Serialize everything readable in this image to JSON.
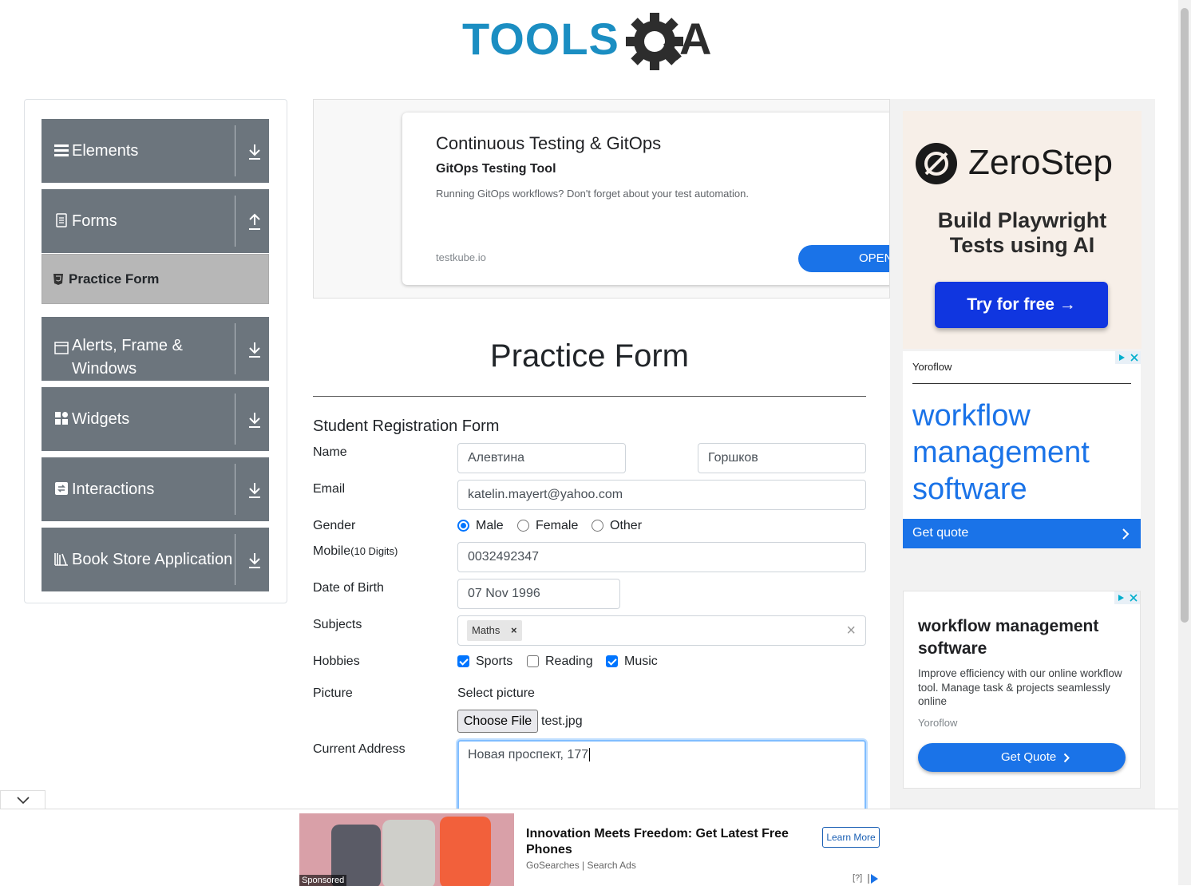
{
  "logo": {
    "text_left": "TOOLS",
    "text_right": "A"
  },
  "sidebar": {
    "groups": [
      {
        "label": "Elements",
        "icon": "hamburger-icon",
        "arrow": "download-icon"
      },
      {
        "label": "Forms",
        "icon": "document-icon",
        "arrow": "upload-icon"
      },
      {
        "label": "Alerts, Frame &",
        "label2": "Windows",
        "icon": "window-icon",
        "arrow": "download-icon"
      },
      {
        "label": "Widgets",
        "icon": "widgets-icon",
        "arrow": "download-icon"
      },
      {
        "label": "Interactions",
        "icon": "interactions-icon",
        "arrow": "download-icon"
      },
      {
        "label": "Book Store Application",
        "icon": "books-icon",
        "arrow": "download-icon"
      }
    ],
    "subitem": {
      "label": "Practice Form",
      "icon": "html5-icon"
    }
  },
  "topad": {
    "title": "Continuous Testing & GitOps",
    "subtitle": "GitOps Testing Tool",
    "body": "Running GitOps workflows? Don't forget about your test automation.",
    "domain": "testkube.io",
    "button": "OPEN"
  },
  "page": {
    "title": "Practice Form",
    "form_title": "Student Registration Form"
  },
  "form": {
    "name_label": "Name",
    "first_name": "Алевтина",
    "last_name": "Горшков",
    "email_label": "Email",
    "email": "katelin.mayert@yahoo.com",
    "gender_label": "Gender",
    "gender_options": [
      "Male",
      "Female",
      "Other"
    ],
    "gender_selected": "Male",
    "mobile_label": "Mobile",
    "mobile_hint": "(10 Digits)",
    "mobile": "0032492347",
    "dob_label": "Date of Birth",
    "dob": "07 Nov 1996",
    "subjects_label": "Subjects",
    "subjects": [
      "Maths"
    ],
    "subject_remove": "×",
    "subjects_clear": "×",
    "hobbies_label": "Hobbies",
    "hobbies": [
      {
        "label": "Sports",
        "checked": true
      },
      {
        "label": "Reading",
        "checked": false
      },
      {
        "label": "Music",
        "checked": true
      }
    ],
    "picture_label": "Picture",
    "select_picture": "Select picture",
    "choose_file": "Choose File",
    "file_name": "test.jpg",
    "address_label": "Current Address",
    "address": "Новая проспект, 177"
  },
  "ads": {
    "zerostep": {
      "brand": "ZeroStep",
      "headline1": "Build Playwright",
      "headline2": "Tests using AI",
      "cta": "Try for free →"
    },
    "yoroflow1": {
      "brand": "Yoroflow",
      "headline1": "workflow",
      "headline2": "management",
      "headline3": "software",
      "cta": "Get quote"
    },
    "yoroflow2": {
      "headline1": "workflow management",
      "headline2": "software",
      "body": "Improve efficiency with our online workflow tool. Manage task & projects seamlessly online",
      "brand": "Yoroflow",
      "cta": "Get Quote"
    },
    "bottom": {
      "headline1": "Innovation Meets Freedom: Get Latest Free",
      "headline2": "Phones",
      "source": "GoSearches | Search Ads",
      "cta": "Learn More",
      "sponsored": "Sponsored",
      "help": "[?]"
    }
  },
  "colors": {
    "sidebar_bg": "#6c757d",
    "accent": "#0075ff",
    "logo_blue": "#1b8ec2",
    "ad_blue": "#1a73e8",
    "zerostep_btn": "#1036e0"
  }
}
